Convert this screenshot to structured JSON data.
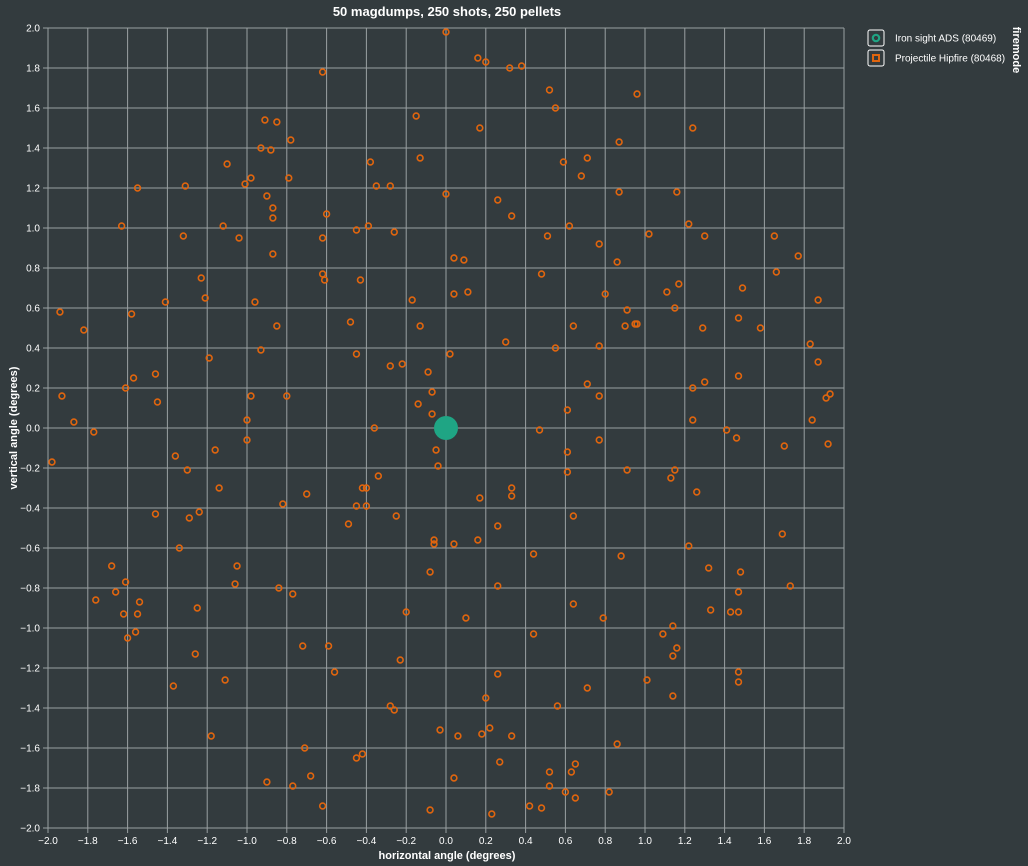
{
  "colors": {
    "background": "#333b3e",
    "grid": "#9aa0a2",
    "ads": "#1fa584",
    "hipfire": "#e0650e",
    "text": "#ffffff"
  },
  "chart_data": {
    "type": "scatter",
    "title": "50 magdumps, 250 shots, 250 pellets",
    "xlabel": "horizontal angle (degrees)",
    "ylabel": "vertical angle (degrees)",
    "xlim": [
      -2.0,
      2.0
    ],
    "ylim": [
      -2.0,
      2.0
    ],
    "x_ticks": [
      "−2.0",
      "−1.8",
      "−1.6",
      "−1.4",
      "−1.2",
      "−1.0",
      "−0.8",
      "−0.6",
      "−0.4",
      "−0.2",
      "0.0",
      "0.2",
      "0.4",
      "0.6",
      "0.8",
      "1.0",
      "1.2",
      "1.4",
      "1.6",
      "1.8",
      "2.0"
    ],
    "y_ticks": [
      "2.0",
      "1.8",
      "1.6",
      "1.4",
      "1.2",
      "1.0",
      "0.8",
      "0.6",
      "0.4",
      "0.2",
      "0.0",
      "−0.2",
      "−0.4",
      "−0.6",
      "−0.8",
      "−1.0",
      "−1.2",
      "−1.4",
      "−1.6",
      "−1.8",
      "−2.0"
    ],
    "grid": true,
    "legend": {
      "title": "firemode",
      "placement": "top-right",
      "entries": [
        "Iron sight ADS (80469)",
        "Projectile Hipfire (80468)"
      ]
    },
    "series": [
      {
        "name": "Iron sight ADS (80469)",
        "color": "#1fa584",
        "points": [
          [
            0.0,
            0.0
          ]
        ]
      },
      {
        "name": "Projectile Hipfire (80468)",
        "color": "#e0650e",
        "points": [
          [
            0.0,
            1.98
          ],
          [
            0.16,
            1.85
          ],
          [
            0.2,
            1.83
          ],
          [
            0.32,
            1.8
          ],
          [
            0.38,
            1.81
          ],
          [
            -0.62,
            1.78
          ],
          [
            0.52,
            1.69
          ],
          [
            0.96,
            1.67
          ],
          [
            0.55,
            1.6
          ],
          [
            -0.15,
            1.56
          ],
          [
            -0.91,
            1.54
          ],
          [
            -0.85,
            1.53
          ],
          [
            0.17,
            1.5
          ],
          [
            1.24,
            1.5
          ],
          [
            -0.78,
            1.44
          ],
          [
            0.87,
            1.43
          ],
          [
            -0.93,
            1.4
          ],
          [
            -0.88,
            1.39
          ],
          [
            0.71,
            1.35
          ],
          [
            -0.13,
            1.35
          ],
          [
            0.59,
            1.33
          ],
          [
            -0.38,
            1.33
          ],
          [
            -1.1,
            1.32
          ],
          [
            0.68,
            1.26
          ],
          [
            -0.98,
            1.25
          ],
          [
            -0.79,
            1.25
          ],
          [
            -1.01,
            1.22
          ],
          [
            -1.31,
            1.21
          ],
          [
            -1.55,
            1.2
          ],
          [
            -0.35,
            1.21
          ],
          [
            -0.28,
            1.21
          ],
          [
            1.16,
            1.18
          ],
          [
            0.87,
            1.18
          ],
          [
            0.0,
            1.17
          ],
          [
            -0.9,
            1.16
          ],
          [
            0.26,
            1.14
          ],
          [
            -0.87,
            1.1
          ],
          [
            0.33,
            1.06
          ],
          [
            -0.87,
            1.05
          ],
          [
            -0.6,
            1.07
          ],
          [
            1.22,
            1.02
          ],
          [
            0.62,
            1.01
          ],
          [
            -0.39,
            1.01
          ],
          [
            -1.12,
            1.01
          ],
          [
            -1.63,
            1.01
          ],
          [
            -0.45,
            0.99
          ],
          [
            -0.26,
            0.98
          ],
          [
            1.02,
            0.97
          ],
          [
            0.51,
            0.96
          ],
          [
            1.3,
            0.96
          ],
          [
            1.65,
            0.96
          ],
          [
            -1.32,
            0.96
          ],
          [
            -0.62,
            0.95
          ],
          [
            -1.04,
            0.95
          ],
          [
            0.77,
            0.92
          ],
          [
            -0.87,
            0.87
          ],
          [
            1.77,
            0.86
          ],
          [
            0.04,
            0.85
          ],
          [
            0.09,
            0.84
          ],
          [
            0.86,
            0.83
          ],
          [
            -0.62,
            0.77
          ],
          [
            0.48,
            0.77
          ],
          [
            -0.61,
            0.74
          ],
          [
            -0.43,
            0.74
          ],
          [
            1.66,
            0.78
          ],
          [
            -1.23,
            0.75
          ],
          [
            1.17,
            0.72
          ],
          [
            1.49,
            0.7
          ],
          [
            0.8,
            0.67
          ],
          [
            0.04,
            0.67
          ],
          [
            0.11,
            0.68
          ],
          [
            1.11,
            0.68
          ],
          [
            -1.21,
            0.65
          ],
          [
            -1.41,
            0.63
          ],
          [
            -0.17,
            0.64
          ],
          [
            -0.96,
            0.63
          ],
          [
            1.87,
            0.64
          ],
          [
            1.15,
            0.6
          ],
          [
            0.91,
            0.59
          ],
          [
            -1.94,
            0.58
          ],
          [
            -1.58,
            0.57
          ],
          [
            1.47,
            0.55
          ],
          [
            -0.48,
            0.53
          ],
          [
            0.96,
            0.52
          ],
          [
            0.95,
            0.52
          ],
          [
            0.64,
            0.51
          ],
          [
            0.9,
            0.51
          ],
          [
            -0.85,
            0.51
          ],
          [
            -0.13,
            0.51
          ],
          [
            1.29,
            0.5
          ],
          [
            1.58,
            0.5
          ],
          [
            -1.82,
            0.49
          ],
          [
            0.3,
            0.43
          ],
          [
            1.83,
            0.42
          ],
          [
            0.77,
            0.41
          ],
          [
            0.55,
            0.4
          ],
          [
            -0.93,
            0.39
          ],
          [
            -0.45,
            0.37
          ],
          [
            0.02,
            0.37
          ],
          [
            -1.19,
            0.35
          ],
          [
            1.87,
            0.33
          ],
          [
            -0.22,
            0.32
          ],
          [
            -0.28,
            0.31
          ],
          [
            -0.09,
            0.28
          ],
          [
            -1.46,
            0.27
          ],
          [
            -1.57,
            0.25
          ],
          [
            1.47,
            0.26
          ],
          [
            0.71,
            0.22
          ],
          [
            1.3,
            0.23
          ],
          [
            1.24,
            0.2
          ],
          [
            -1.61,
            0.2
          ],
          [
            -0.07,
            0.18
          ],
          [
            -0.8,
            0.16
          ],
          [
            -0.98,
            0.16
          ],
          [
            0.77,
            0.16
          ],
          [
            -1.93,
            0.16
          ],
          [
            1.93,
            0.17
          ],
          [
            1.91,
            0.15
          ],
          [
            -1.45,
            0.13
          ],
          [
            -0.14,
            0.12
          ],
          [
            0.61,
            0.09
          ],
          [
            -0.07,
            0.07
          ],
          [
            -1.0,
            0.04
          ],
          [
            1.24,
            0.04
          ],
          [
            -1.87,
            0.03
          ],
          [
            1.84,
            0.04
          ],
          [
            -0.36,
            0.0
          ],
          [
            1.41,
            -0.01
          ],
          [
            -1.77,
            -0.02
          ],
          [
            0.47,
            -0.01
          ],
          [
            1.46,
            -0.05
          ],
          [
            0.77,
            -0.06
          ],
          [
            -1.0,
            -0.06
          ],
          [
            1.7,
            -0.09
          ],
          [
            1.92,
            -0.08
          ],
          [
            -0.05,
            -0.11
          ],
          [
            -1.16,
            -0.11
          ],
          [
            0.61,
            -0.12
          ],
          [
            -1.36,
            -0.14
          ],
          [
            -1.98,
            -0.17
          ],
          [
            -0.04,
            -0.19
          ],
          [
            -1.3,
            -0.21
          ],
          [
            0.91,
            -0.21
          ],
          [
            0.61,
            -0.22
          ],
          [
            1.15,
            -0.21
          ],
          [
            1.13,
            -0.25
          ],
          [
            -0.34,
            -0.24
          ],
          [
            -1.14,
            -0.3
          ],
          [
            0.33,
            -0.3
          ],
          [
            -0.42,
            -0.3
          ],
          [
            -0.4,
            -0.3
          ],
          [
            -0.7,
            -0.33
          ],
          [
            0.17,
            -0.35
          ],
          [
            0.33,
            -0.34
          ],
          [
            1.26,
            -0.32
          ],
          [
            -0.82,
            -0.38
          ],
          [
            -0.45,
            -0.39
          ],
          [
            -0.4,
            -0.39
          ],
          [
            -1.46,
            -0.43
          ],
          [
            -0.25,
            -0.44
          ],
          [
            0.64,
            -0.44
          ],
          [
            -1.29,
            -0.45
          ],
          [
            -1.24,
            -0.42
          ],
          [
            -0.49,
            -0.48
          ],
          [
            0.26,
            -0.49
          ],
          [
            -0.06,
            -0.56
          ],
          [
            0.16,
            -0.56
          ],
          [
            1.69,
            -0.53
          ],
          [
            -0.06,
            -0.58
          ],
          [
            0.04,
            -0.58
          ],
          [
            -1.34,
            -0.6
          ],
          [
            1.22,
            -0.59
          ],
          [
            0.44,
            -0.63
          ],
          [
            0.88,
            -0.64
          ],
          [
            -1.68,
            -0.69
          ],
          [
            -1.05,
            -0.69
          ],
          [
            1.32,
            -0.7
          ],
          [
            1.48,
            -0.72
          ],
          [
            -0.08,
            -0.72
          ],
          [
            -1.61,
            -0.77
          ],
          [
            -1.06,
            -0.78
          ],
          [
            -0.84,
            -0.8
          ],
          [
            1.73,
            -0.79
          ],
          [
            0.26,
            -0.79
          ],
          [
            -1.66,
            -0.82
          ],
          [
            -0.77,
            -0.83
          ],
          [
            1.47,
            -0.82
          ],
          [
            -1.76,
            -0.86
          ],
          [
            -1.54,
            -0.87
          ],
          [
            0.64,
            -0.88
          ],
          [
            -1.25,
            -0.9
          ],
          [
            -0.2,
            -0.92
          ],
          [
            1.33,
            -0.91
          ],
          [
            1.43,
            -0.92
          ],
          [
            1.47,
            -0.92
          ],
          [
            -1.62,
            -0.93
          ],
          [
            -1.55,
            -0.93
          ],
          [
            0.1,
            -0.95
          ],
          [
            0.79,
            -0.95
          ],
          [
            1.14,
            -0.99
          ],
          [
            -1.56,
            -1.02
          ],
          [
            1.09,
            -1.03
          ],
          [
            0.44,
            -1.03
          ],
          [
            -1.6,
            -1.05
          ],
          [
            -0.72,
            -1.09
          ],
          [
            -0.59,
            -1.09
          ],
          [
            1.16,
            -1.1
          ],
          [
            1.14,
            -1.14
          ],
          [
            -1.26,
            -1.13
          ],
          [
            -0.23,
            -1.16
          ],
          [
            1.47,
            -1.22
          ],
          [
            -0.56,
            -1.22
          ],
          [
            0.26,
            -1.23
          ],
          [
            1.01,
            -1.26
          ],
          [
            -1.11,
            -1.26
          ],
          [
            1.47,
            -1.27
          ],
          [
            -1.37,
            -1.29
          ],
          [
            0.71,
            -1.3
          ],
          [
            1.14,
            -1.34
          ],
          [
            0.2,
            -1.35
          ],
          [
            0.56,
            -1.39
          ],
          [
            -0.28,
            -1.39
          ],
          [
            -0.26,
            -1.41
          ],
          [
            0.22,
            -1.5
          ],
          [
            -0.03,
            -1.51
          ],
          [
            0.06,
            -1.54
          ],
          [
            0.18,
            -1.53
          ],
          [
            0.33,
            -1.54
          ],
          [
            -1.18,
            -1.54
          ],
          [
            0.86,
            -1.58
          ],
          [
            -0.71,
            -1.6
          ],
          [
            -0.42,
            -1.63
          ],
          [
            -0.45,
            -1.65
          ],
          [
            0.27,
            -1.67
          ],
          [
            0.65,
            -1.68
          ],
          [
            -0.68,
            -1.74
          ],
          [
            0.52,
            -1.72
          ],
          [
            0.63,
            -1.72
          ],
          [
            0.04,
            -1.75
          ],
          [
            -0.9,
            -1.77
          ],
          [
            -0.77,
            -1.79
          ],
          [
            0.52,
            -1.79
          ],
          [
            0.6,
            -1.82
          ],
          [
            0.82,
            -1.82
          ],
          [
            0.65,
            -1.85
          ],
          [
            -0.62,
            -1.89
          ],
          [
            0.42,
            -1.89
          ],
          [
            0.48,
            -1.9
          ],
          [
            -0.08,
            -1.91
          ],
          [
            0.23,
            -1.93
          ]
        ]
      }
    ]
  }
}
